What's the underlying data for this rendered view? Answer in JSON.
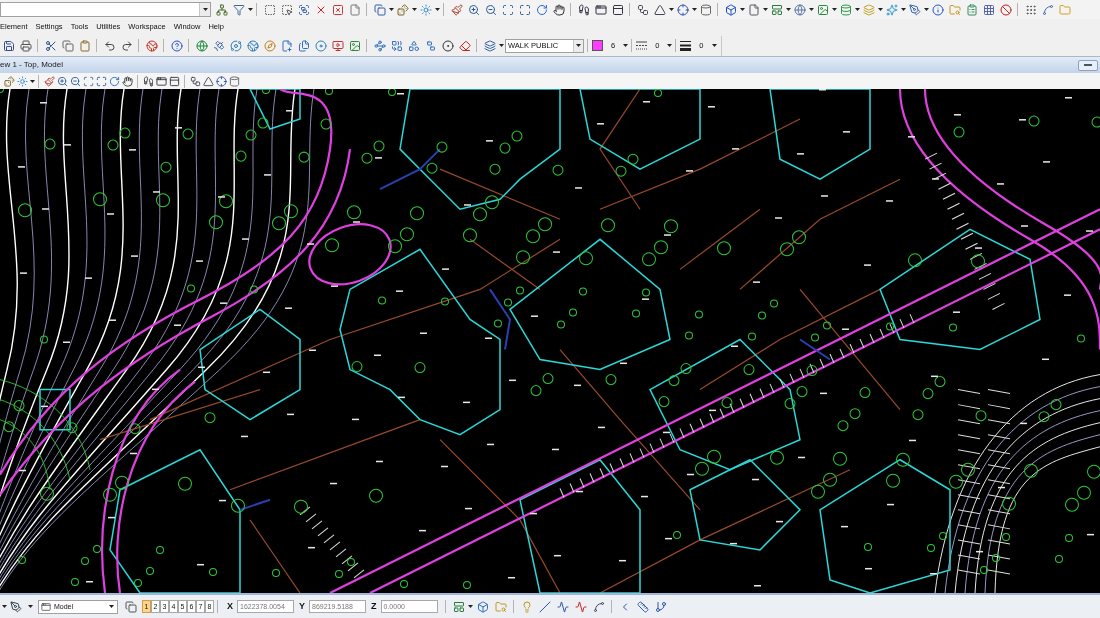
{
  "menu_bar": [
    "Element",
    "Settings",
    "Tools",
    "Utilities",
    "Workspace",
    "Window",
    "Help"
  ],
  "attributes_toolbar": {
    "level": "WALK PUBLIC",
    "active_color": {
      "color": "#ff3dff",
      "number": "6"
    },
    "line_style": "0",
    "line_weight": "0"
  },
  "view": {
    "title": "ew 1 - Top, Model"
  },
  "status_bar": {
    "model": "Model",
    "views": [
      {
        "label": "1",
        "selected": true
      },
      {
        "label": "2",
        "selected": false
      },
      {
        "label": "3",
        "selected": false
      },
      {
        "label": "4",
        "selected": false
      },
      {
        "label": "5",
        "selected": false
      },
      {
        "label": "6",
        "selected": false
      },
      {
        "label": "7",
        "selected": false
      },
      {
        "label": "8",
        "selected": false
      }
    ],
    "coordinates": [
      {
        "axis": "X",
        "value": "1622378.0054"
      },
      {
        "axis": "Y",
        "value": "869219.5188"
      },
      {
        "axis": "Z",
        "value": "0.0000"
      }
    ]
  }
}
